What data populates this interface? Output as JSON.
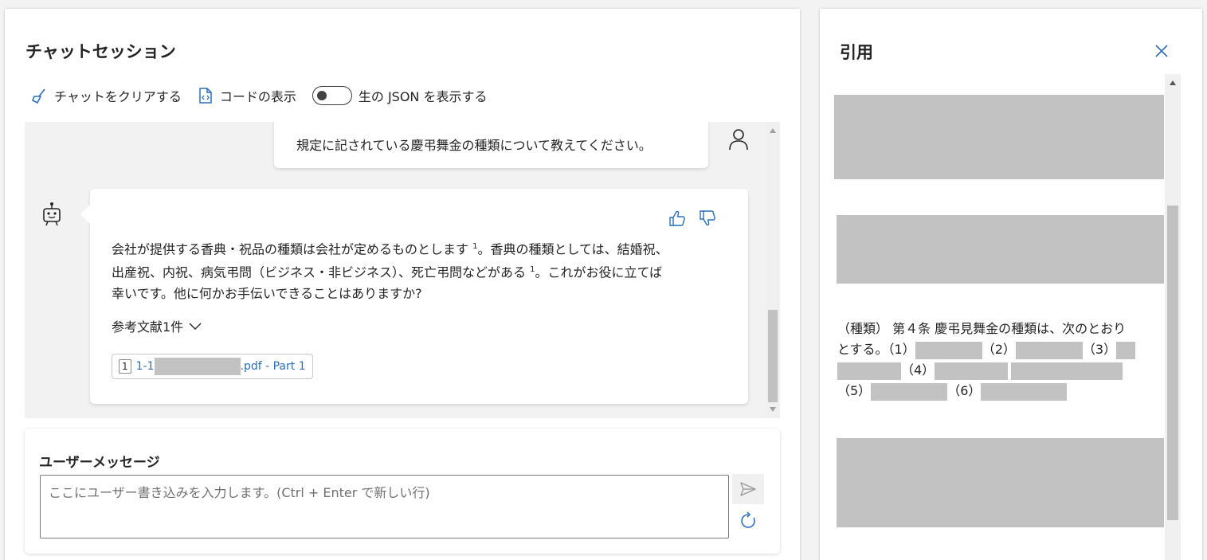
{
  "chat": {
    "title": "チャットセッション",
    "toolbar": {
      "clear_label": "チャットをクリアする",
      "code_label": "コードの表示",
      "json_label": "生の JSON を表示する",
      "json_toggle_on": false
    },
    "messages": {
      "user_text": "規定に記されている慶弔舞金の種類について教えてください。",
      "bot_line1": "会社が提供する香典・祝品の種類は会社が定めるものとします",
      "bot_ref1": "1",
      "bot_line1b": "。香典の種類としては、結婚祝、",
      "bot_line2": "出産祝、内祝、病気弔問（ビジネス・非ビジネス）、死亡弔問などがある",
      "bot_ref2": "1",
      "bot_line2b": "。これがお役に立てば",
      "bot_line3": "幸いです。他に何かお手伝いできることはありますか?",
      "references_label": "参考文献1件",
      "reference_chip": {
        "number": "1",
        "prefix": "1-1",
        "suffix": ".pdf - Part 1"
      }
    },
    "input": {
      "label": "ユーザーメッセージ",
      "placeholder": "ここにユーザー書き込みを入力します。(Ctrl + Enter で新しい行)"
    }
  },
  "citation": {
    "title": "引用",
    "text_line1": "（種類） 第４条 慶弔見舞金の種類は、次のとおり",
    "text_line2_a": "とする。（1）",
    "text_line2_b": "（2）",
    "text_line2_c": "（3）",
    "text_line3_a": "（4）",
    "text_line4_a": "（5）",
    "text_line4_b": "（6）"
  },
  "colors": {
    "accent": "#2b6fb9",
    "redaction": "#c2c2c2",
    "chat_bg": "#f2f2f2"
  }
}
